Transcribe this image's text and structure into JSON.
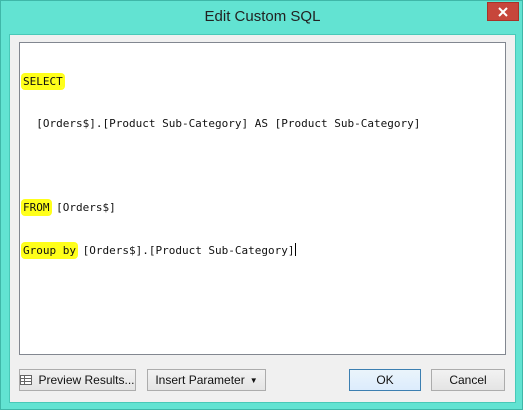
{
  "window": {
    "title": "Edit Custom SQL",
    "close_icon": "close-icon"
  },
  "editor": {
    "lines": [
      {
        "kw": "SELECT",
        "rest": ""
      },
      {
        "kw": "",
        "rest": "  [Orders$].[Product Sub-Category] AS [Product Sub-Category]"
      },
      {
        "kw": "",
        "rest": ""
      },
      {
        "kw": "FROM",
        "rest": " [Orders$]"
      },
      {
        "kw": "Group by",
        "rest": " [Orders$].[Product Sub-Category]"
      }
    ],
    "highlight_color": "#ffff1a"
  },
  "buttons": {
    "preview": "Preview Results...",
    "insert_parameter": "Insert Parameter",
    "ok": "OK",
    "cancel": "Cancel"
  },
  "colors": {
    "frame": "#62e3d2",
    "close_button": "#c7463b",
    "client_bg": "#f0f0f0"
  }
}
